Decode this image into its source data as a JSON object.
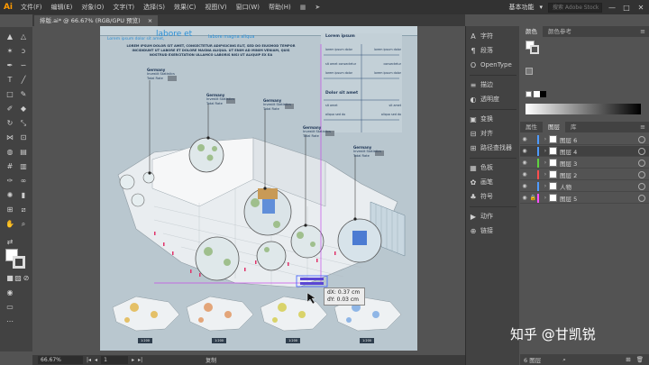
{
  "app": {
    "logo": "Ai"
  },
  "menu": [
    "文件(F)",
    "编辑(E)",
    "对象(O)",
    "文字(T)",
    "选择(S)",
    "效果(C)",
    "视图(V)",
    "窗口(W)",
    "帮助(H)"
  ],
  "workspace": "基本功能",
  "search_placeholder": "搜索 Adobe Stock",
  "window_controls": [
    "—",
    "□",
    "✕"
  ],
  "document_tab": "排版.ai* @ 66.67% (RGB/GPU 预览)",
  "tab_close": "×",
  "artboard": {
    "headline": "labore et",
    "headline2": "labore magna aliqua",
    "intro_small": "Lorem ipsum dolor sit amet,",
    "body_lines": [
      "LOREM IPSUM DOLOR SIT AMET, CONSECTETUR ADIPISICING ELIT, SED DO EIUSMOD TEMPOR",
      "INCIDIDUNT UT LABORE ET DOLORE MAGNA ALIQUA. UT ENIM AD MINIM VENIAM, QUIS",
      "NOSTRUD EXERCITATION ULLAMCO LABORIS NISI UT ALIQUIP EX EA"
    ],
    "side_title1": "Lorem ipsum",
    "side_title2": "Dolor sit amet",
    "annotations": [
      {
        "title": "Germany",
        "line1": "Investit Statistics",
        "line2": "Total Rate"
      },
      {
        "title": "Germany",
        "line1": "Investit Statistics",
        "line2": "Total Rate"
      },
      {
        "title": "Germany",
        "line1": "Investit Statistics",
        "line2": "Total Rate"
      },
      {
        "title": "Germany",
        "line1": "Investit Statistics",
        "line2": "Total Rate"
      },
      {
        "title": "Germany",
        "line1": "Investit Statistics",
        "line2": "Total Rate"
      }
    ],
    "side_rows": [
      {
        "left": "lorem ipsum dolor",
        "right": "lorem ipsum dolor"
      },
      {
        "left": "sit amet consectetur",
        "right": "consectetur"
      },
      {
        "left": "lorem ipsum dolor",
        "right": "lorem ipsum dolor"
      },
      {
        "left": "sit amet",
        "right": "sit amet"
      },
      {
        "left": "aliqua sed do",
        "right": "aliqua sed do"
      }
    ],
    "thumb_labels": [
      "1:200",
      "1:200",
      "1:200",
      "1:200"
    ],
    "measure_dx": "dX: 0.37 cm",
    "measure_dy": "dY: 0.03 cm"
  },
  "status": {
    "zoom": "66.67%",
    "page": "1",
    "mode": "复制"
  },
  "panel_items": [
    {
      "icon": "A",
      "label": "字符"
    },
    {
      "icon": "¶",
      "label": "段落"
    },
    {
      "icon": "O",
      "label": "OpenType"
    },
    {
      "icon": "≡",
      "label": "描边"
    },
    {
      "icon": "◐",
      "label": "透明度"
    },
    {
      "icon": "▣",
      "label": "变换"
    },
    {
      "icon": "⊟",
      "label": "对齐"
    },
    {
      "icon": "⊞",
      "label": "路径查找器"
    },
    {
      "icon": "▦",
      "label": "色板"
    },
    {
      "icon": "✿",
      "label": "画笔"
    },
    {
      "icon": "♣",
      "label": "符号"
    },
    {
      "icon": "▶",
      "label": "动作"
    },
    {
      "icon": "⊕",
      "label": "链接"
    }
  ],
  "color_tabs": [
    "颜色",
    "颜色参考"
  ],
  "layer_tabs": [
    "属性",
    "图层",
    "库"
  ],
  "layers": [
    {
      "name": "图层 6",
      "color": "#4f9bff",
      "selected": false
    },
    {
      "name": "图层 4",
      "color": "#4f9bff",
      "selected": true
    },
    {
      "name": "图层 3",
      "color": "#5fd33f",
      "selected": false
    },
    {
      "name": "图层 2",
      "color": "#ff4e4e",
      "selected": false
    },
    {
      "name": "人物",
      "color": "#4f9bff",
      "selected": false
    },
    {
      "name": "图层 5",
      "color": "#ff4eff",
      "selected": false
    }
  ],
  "layers_footer": "6 图层",
  "watermark": "知乎 @甘凯锐"
}
